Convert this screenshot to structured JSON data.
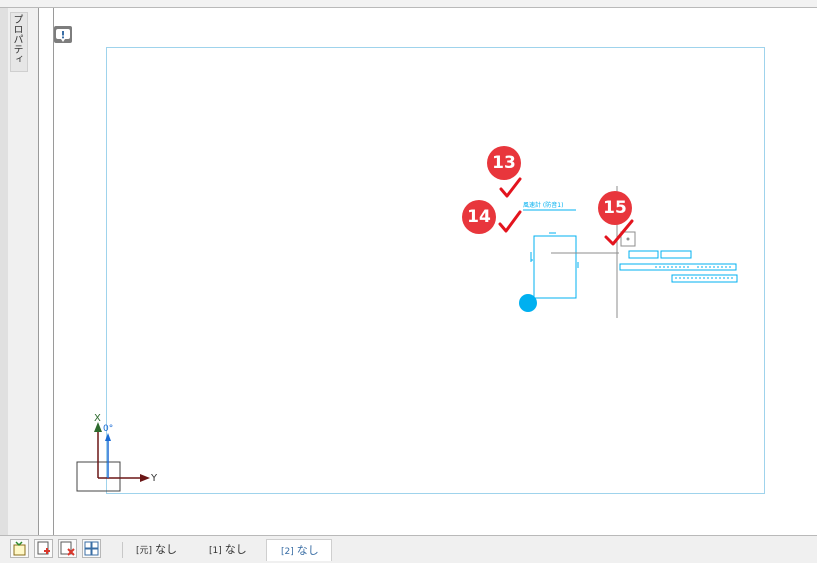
{
  "left_panel": {
    "property_tab_label": "プロパティ"
  },
  "sheet": {
    "title_label": "風速計 (防音1)",
    "callouts": [
      "13",
      "14",
      "15"
    ],
    "origin_axis": {
      "x_label": "X",
      "y_label": "Y",
      "angle_label": "0°"
    }
  },
  "bottom_tabs": [
    {
      "prefix": "[元]",
      "label": "なし"
    },
    {
      "prefix": "[1]",
      "label": "なし"
    },
    {
      "prefix": "[2]",
      "label": "なし"
    }
  ],
  "colors": {
    "drawing": "#00b0f0",
    "callout": "#e8363c",
    "check": "#e3141e",
    "axis": "#6b1616"
  },
  "icons": [
    "new-sheet-icon",
    "add-sheet-icon",
    "delete-sheet-icon",
    "sheet-list-icon",
    "warning-icon",
    "checkmark-icon"
  ]
}
